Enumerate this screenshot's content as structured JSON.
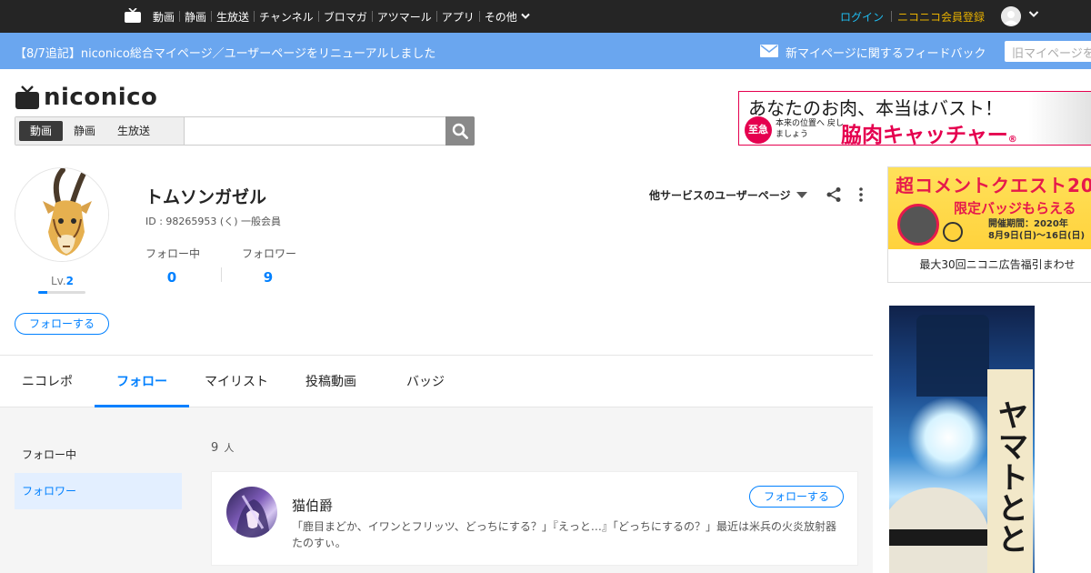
{
  "topnav": {
    "items": [
      "動画",
      "静画",
      "生放送",
      "チャンネル",
      "ブロマガ",
      "アツマール",
      "アプリ"
    ],
    "more": "その他",
    "login": "ログイン",
    "register": "ニコニコ会員登録"
  },
  "notice": {
    "text": "【8/7追記】niconico総合マイページ／ユーザーページをリニューアルしました",
    "feedback": "新マイページに関するフィードバック",
    "old_page": "旧マイページを"
  },
  "brand": {
    "logo_text": "niconico"
  },
  "search": {
    "tabs": [
      "動画",
      "静画",
      "生放送"
    ],
    "active_tab": "動画",
    "value": "",
    "placeholder": ""
  },
  "ad_top": {
    "headline": "あなたのお肉、本当はバスト！",
    "badge": "至急",
    "sub": "本来の位置へ 戻しましょう",
    "product": "脇肉キャッチャー",
    "mark": "®"
  },
  "profile": {
    "name": "トムソンガゼル",
    "meta": "ID : 98265953 (く) 一般会員",
    "level_label": "Lv.",
    "level": "2",
    "level_progress": 0.2,
    "follow_button": "フォローする",
    "following_label": "フォロー中",
    "following_count": "0",
    "followers_label": "フォロワー",
    "followers_count": "9",
    "other_service": "他サービスのユーザーページ"
  },
  "tabs": {
    "items": [
      "ニコレポ",
      "フォロー",
      "マイリスト",
      "投稿動画",
      "バッジ"
    ],
    "active": "フォロー"
  },
  "sidebar": {
    "items": [
      "フォロー中",
      "フォロワー"
    ],
    "active": "フォロワー"
  },
  "list": {
    "count": "9",
    "count_unit": "人",
    "users": [
      {
        "name": "猫伯爵",
        "description": "「鹿目まどか、イワンとフリッツ、どっちにする？」『えっと…』「どっちにするの？」最近は米兵の火炎放射器たのすぃ。",
        "follow_button": "フォローする"
      }
    ]
  },
  "ad_side": {
    "title": "超コメントクエスト20",
    "sub": "限定バッジもらえる",
    "date_line1": "開催期間：2020年",
    "date_line2": "8月9日(日)～16日(日)",
    "caption": "最大30回ニコニ広告福引まわせ"
  },
  "ad_tall": {
    "title": "ヤマトとと"
  },
  "colors": {
    "accent": "#0080ff",
    "topbar": "#252525",
    "notice": "#6aa6ef",
    "login": "#1fbcf0",
    "register": "#e8b100"
  }
}
